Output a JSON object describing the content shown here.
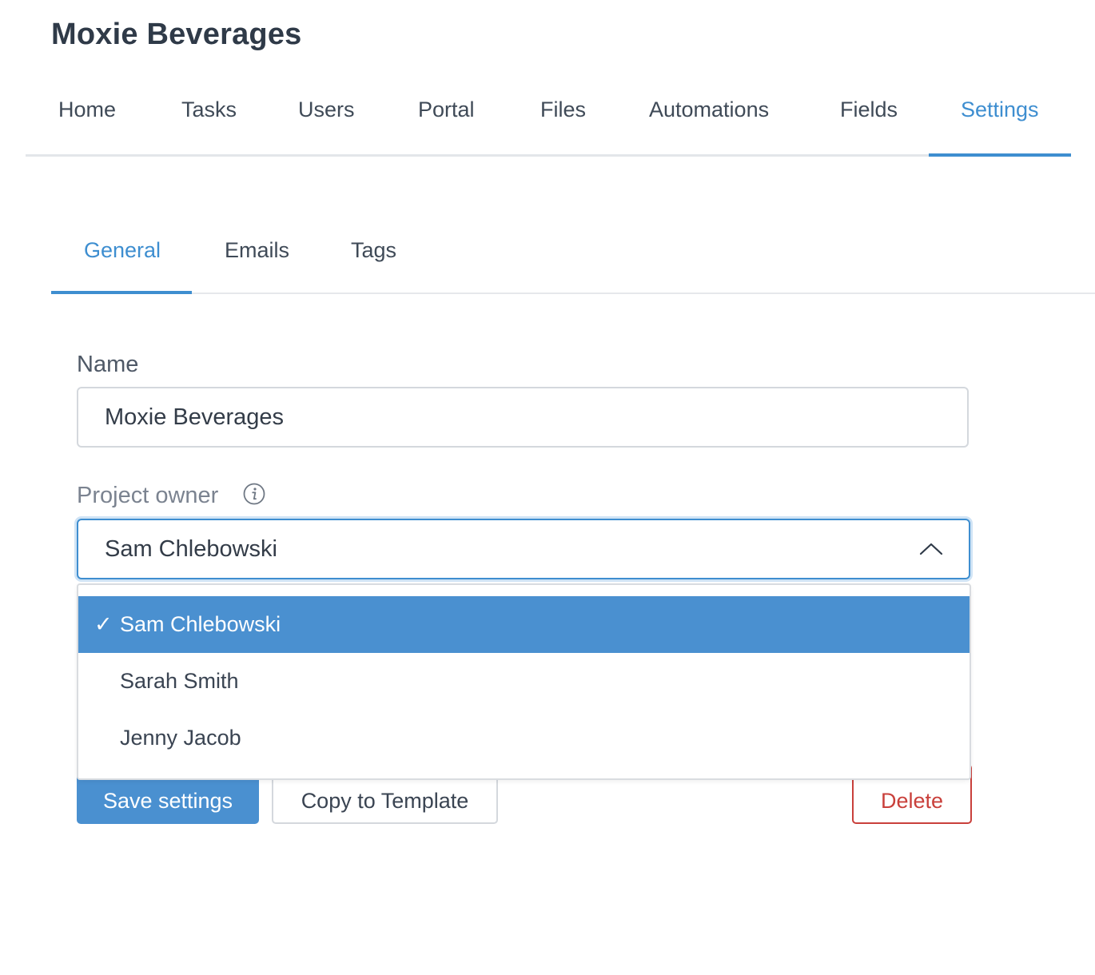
{
  "project": {
    "title": "Moxie Beverages"
  },
  "top_nav": {
    "tabs": [
      {
        "label": "Home"
      },
      {
        "label": "Tasks"
      },
      {
        "label": "Users"
      },
      {
        "label": "Portal"
      },
      {
        "label": "Files"
      },
      {
        "label": "Automations"
      },
      {
        "label": "Fields"
      },
      {
        "label": "Settings",
        "active": true
      }
    ]
  },
  "sub_nav": {
    "tabs": [
      {
        "label": "General",
        "active": true
      },
      {
        "label": "Emails"
      },
      {
        "label": "Tags"
      }
    ]
  },
  "form": {
    "name_label": "Name",
    "name_value": "Moxie Beverages",
    "owner_label": "Project owner",
    "owner_value": "Sam Chlebowski",
    "owner_options": [
      {
        "label": "Sam Chlebowski",
        "selected": true,
        "check": "✓"
      },
      {
        "label": "Sarah Smith"
      },
      {
        "label": "Jenny Jacob"
      }
    ]
  },
  "actions": {
    "save_label": "Save settings",
    "copy_label": "Copy to Template",
    "delete_label": "Delete"
  },
  "colors": {
    "accent": "#3e8ed0",
    "primary_button": "#4a90d0",
    "danger": "#c9403b"
  },
  "icons": {
    "info": "info-icon",
    "chevron": "chevron-up-icon",
    "check": "check-icon"
  }
}
